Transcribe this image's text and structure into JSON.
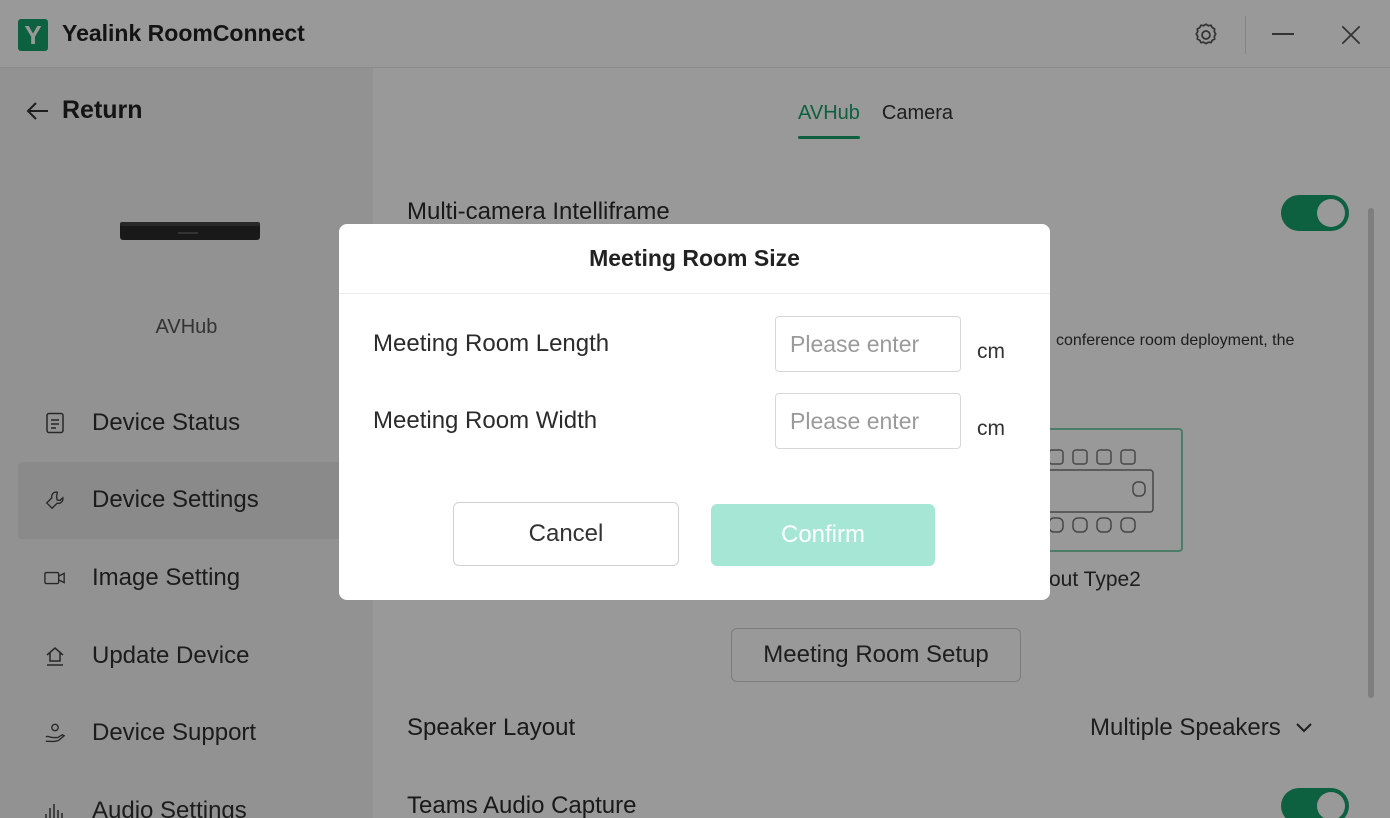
{
  "app": {
    "logo_letter": "Y",
    "title": "Yealink RoomConnect"
  },
  "titlebar": {
    "settings_icon": "gear-icon",
    "minimize_icon": "minimize-icon",
    "close_icon": "close-icon"
  },
  "sidebar": {
    "return_label": "Return",
    "device_name": "AVHub",
    "items": [
      {
        "label": "Device Status",
        "icon": "document-icon",
        "active": false
      },
      {
        "label": "Device Settings",
        "icon": "wrench-icon",
        "active": true
      },
      {
        "label": "Image Setting",
        "icon": "camera-icon",
        "active": false
      },
      {
        "label": "Update Device",
        "icon": "upload-icon",
        "active": false
      },
      {
        "label": "Device Support",
        "icon": "support-icon",
        "active": false
      },
      {
        "label": "Audio Settings",
        "icon": "audio-bars-icon",
        "active": false
      }
    ]
  },
  "main": {
    "tabs": [
      {
        "label": "AVHub",
        "active": true
      },
      {
        "label": "Camera",
        "active": false
      }
    ],
    "intelliframe_label": "Multi-camera Intelliframe",
    "intelliframe_on": true,
    "deployment_desc_fragment": "conference room deployment, the",
    "layout_type_label_fragment": "out Type2",
    "setup_button": "Meeting Room Setup",
    "speaker_layout_label": "Speaker Layout",
    "speaker_layout_value": "Multiple Speakers",
    "teams_audio_label": "Teams Audio Capture",
    "teams_audio_on": true
  },
  "dialog": {
    "title": "Meeting Room Size",
    "length_label": "Meeting Room Length",
    "length_value": "",
    "length_placeholder": "Please enter",
    "width_label": "Meeting Room Width",
    "width_value": "",
    "width_placeholder": "Please enter",
    "unit": "cm",
    "cancel_label": "Cancel",
    "confirm_label": "Confirm"
  },
  "colors": {
    "accent": "#17a06b",
    "confirm_disabled": "#a5e6d4",
    "overlay": "rgba(0,0,0,0.40)"
  }
}
